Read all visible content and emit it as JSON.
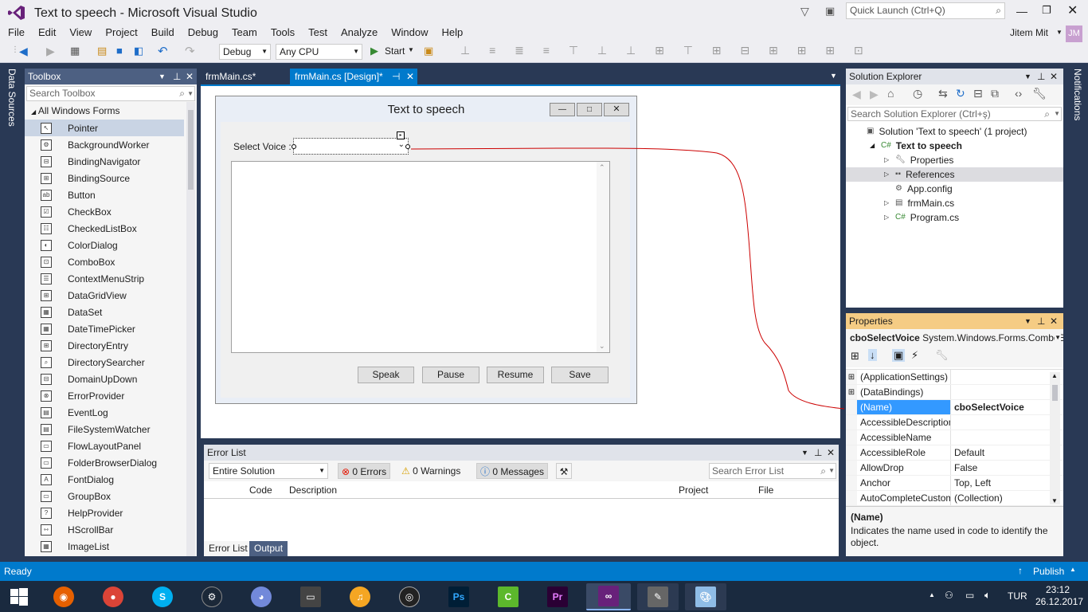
{
  "window": {
    "title": "Text to speech - Microsoft Visual Studio",
    "quick_launch": "Quick Launch (Ctrl+Q)",
    "user": "Jitem Mit",
    "user_initials": "JM"
  },
  "menu": [
    "File",
    "Edit",
    "View",
    "Project",
    "Build",
    "Debug",
    "Team",
    "Tools",
    "Test",
    "Analyze",
    "Window",
    "Help"
  ],
  "toolbar": {
    "config": "Debug",
    "platform": "Any CPU",
    "start": "Start"
  },
  "side_tabs": {
    "left": "Data Sources",
    "right": "Notifications"
  },
  "toolbox": {
    "title": "Toolbox",
    "search": "Search Toolbox",
    "group": "All Windows Forms",
    "items": [
      "Pointer",
      "BackgroundWorker",
      "BindingNavigator",
      "BindingSource",
      "Button",
      "CheckBox",
      "CheckedListBox",
      "ColorDialog",
      "ComboBox",
      "ContextMenuStrip",
      "DataGridView",
      "DataSet",
      "DateTimePicker",
      "DirectoryEntry",
      "DirectorySearcher",
      "DomainUpDown",
      "ErrorProvider",
      "EventLog",
      "FileSystemWatcher",
      "FlowLayoutPanel",
      "FolderBrowserDialog",
      "FontDialog",
      "GroupBox",
      "HelpProvider",
      "HScrollBar",
      "ImageList"
    ]
  },
  "doc_tabs": [
    {
      "label": "frmMain.cs*"
    },
    {
      "label": "frmMain.cs [Design]*"
    }
  ],
  "form": {
    "title": "Text to speech",
    "select_label": "Select Voice :",
    "buttons": [
      "Speak",
      "Pause",
      "Resume",
      "Save"
    ]
  },
  "error_list": {
    "title": "Error List",
    "scope": "Entire Solution",
    "errors": "0 Errors",
    "warnings": "0 Warnings",
    "messages": "0 Messages",
    "search": "Search Error List",
    "columns": [
      "Code",
      "Description",
      "Project",
      "File"
    ],
    "bottom_tabs": [
      "Error List",
      "Output"
    ]
  },
  "solution_explorer": {
    "title": "Solution Explorer",
    "search": "Search Solution Explorer (Ctrl+ş)",
    "tree": [
      {
        "label": "Solution 'Text to speech' (1 project)",
        "indent": 0,
        "bold": false
      },
      {
        "label": "Text to speech",
        "indent": 1,
        "bold": true
      },
      {
        "label": "Properties",
        "indent": 2,
        "bold": false
      },
      {
        "label": "References",
        "indent": 2,
        "bold": false
      },
      {
        "label": "App.config",
        "indent": 2,
        "bold": false
      },
      {
        "label": "frmMain.cs",
        "indent": 2,
        "bold": false
      },
      {
        "label": "Program.cs",
        "indent": 2,
        "bold": false
      }
    ]
  },
  "properties": {
    "title": "Properties",
    "object": "cboSelectVoice",
    "type": "System.Windows.Forms.ComboBox",
    "rows": [
      {
        "name": "(ApplicationSettings)",
        "value": ""
      },
      {
        "name": "(DataBindings)",
        "value": ""
      },
      {
        "name": "(Name)",
        "value": "cboSelectVoice"
      },
      {
        "name": "AccessibleDescription",
        "value": ""
      },
      {
        "name": "AccessibleName",
        "value": ""
      },
      {
        "name": "AccessibleRole",
        "value": "Default"
      },
      {
        "name": "AllowDrop",
        "value": "False"
      },
      {
        "name": "Anchor",
        "value": "Top, Left"
      },
      {
        "name": "AutoCompleteCustomSource",
        "value": "(Collection)"
      }
    ],
    "desc_title": "(Name)",
    "desc_text": "Indicates the name used in code to identify the object."
  },
  "status": {
    "text": "Ready",
    "publish": "Publish"
  },
  "taskbar": {
    "lang": "TUR",
    "time": "23:12",
    "date": "26.12.2017"
  },
  "colors": {
    "accent": "#007acc",
    "vs_purple": "#68217a"
  }
}
